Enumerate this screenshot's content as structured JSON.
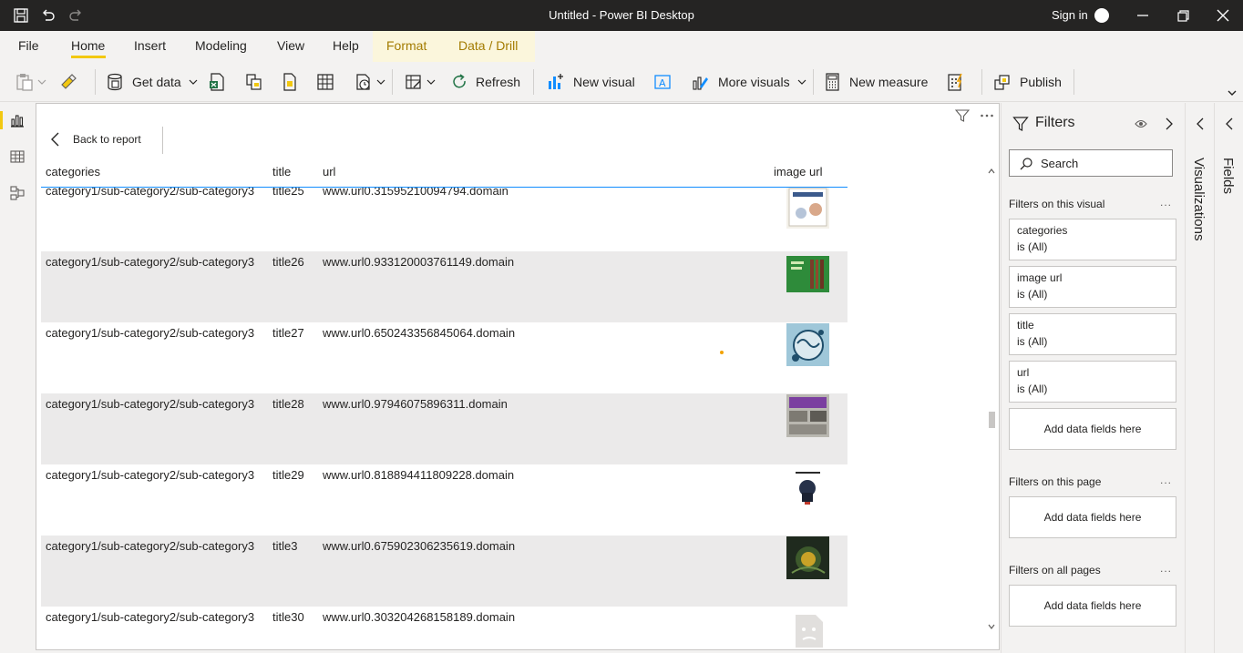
{
  "titlebar": {
    "title": "Untitled - Power BI Desktop",
    "signin": "Sign in"
  },
  "ribbon_tabs": [
    {
      "label": "File"
    },
    {
      "label": "Home"
    },
    {
      "label": "Insert"
    },
    {
      "label": "Modeling"
    },
    {
      "label": "View"
    },
    {
      "label": "Help"
    },
    {
      "label": "Format"
    },
    {
      "label": "Data / Drill"
    }
  ],
  "active_tab": "Home",
  "toolbar": {
    "get_data": "Get data",
    "refresh": "Refresh",
    "new_visual": "New visual",
    "more_visuals": "More visuals",
    "new_measure": "New measure",
    "publish": "Publish"
  },
  "canvas": {
    "back_label": "Back to report",
    "columns": [
      "categories",
      "title",
      "url",
      "image url"
    ],
    "rows": [
      {
        "category": "category1/sub-category2/sub-category3",
        "title": "title25",
        "url": "www.url0.31595210094794.domain",
        "image": "album-cover-mamma-mia"
      },
      {
        "category": "category1/sub-category2/sub-category3",
        "title": "title26",
        "url": "www.url0.933120003761149.domain",
        "image": "album-cover-green-book"
      },
      {
        "category": "category1/sub-category2/sub-category3",
        "title": "title27",
        "url": "www.url0.650243356845064.domain",
        "image": "album-cover-follies"
      },
      {
        "category": "category1/sub-category2/sub-category3",
        "title": "title28",
        "url": "www.url0.97946075896311.domain",
        "image": "album-cover-send-in-clowns"
      },
      {
        "category": "category1/sub-category2/sub-category3",
        "title": "title29",
        "url": "www.url0.818894411809228.domain",
        "image": "album-cover-les-miserables"
      },
      {
        "category": "category1/sub-category2/sub-category3",
        "title": "title3",
        "url": "www.url0.675902306235619.domain",
        "image": "album-cover-dark"
      },
      {
        "category": "category1/sub-category2/sub-category3",
        "title": "title30",
        "url": "www.url0.303204268158189.domain",
        "image": "broken-image-placeholder"
      }
    ]
  },
  "filters": {
    "title": "Filters",
    "search_placeholder": "Search",
    "on_visual": "Filters on this visual",
    "on_page": "Filters on this page",
    "on_all_pages": "Filters on all pages",
    "more": "...",
    "cards": [
      {
        "field": "categories",
        "state": "is (All)"
      },
      {
        "field": "image url",
        "state": "is (All)"
      },
      {
        "field": "title",
        "state": "is (All)"
      },
      {
        "field": "url",
        "state": "is (All)"
      }
    ],
    "add_fields": "Add data fields here"
  },
  "panes": {
    "visualizations": "Visualizations",
    "fields": "Fields"
  },
  "colors": {
    "titlebar": "#252423",
    "accent": "#f2c811",
    "context_tab": "#a37b00",
    "header_line": "#118dff"
  }
}
